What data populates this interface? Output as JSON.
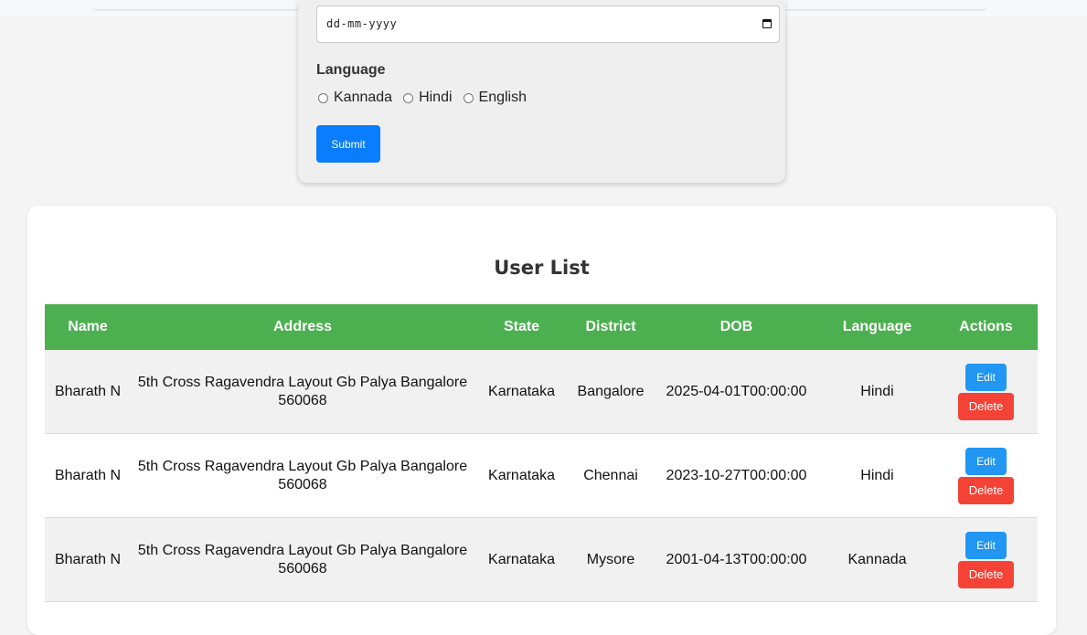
{
  "form": {
    "dob_placeholder": "dd-mm-yyyy",
    "language_label": "Language",
    "language_options": [
      "Kannada",
      "Hindi",
      "English"
    ],
    "submit_label": "Submit"
  },
  "user_list": {
    "title": "User List",
    "columns": [
      "Name",
      "Address",
      "State",
      "District",
      "DOB",
      "Language",
      "Actions"
    ],
    "edit_label": "Edit",
    "delete_label": "Delete",
    "rows": [
      {
        "name": "Bharath N",
        "address": "5th Cross Ragavendra Layout Gb Palya Bangalore 560068",
        "state": "Karnataka",
        "district": "Bangalore",
        "dob": "2025-04-01T00:00:00",
        "language": "Hindi"
      },
      {
        "name": "Bharath N",
        "address": "5th Cross Ragavendra Layout Gb Palya Bangalore 560068",
        "state": "Karnataka",
        "district": "Chennai",
        "dob": "2023-10-27T00:00:00",
        "language": "Hindi"
      },
      {
        "name": "Bharath N",
        "address": "5th Cross Ragavendra Layout Gb Palya Bangalore 560068",
        "state": "Karnataka",
        "district": "Mysore",
        "dob": "2001-04-13T00:00:00",
        "language": "Kannada"
      }
    ]
  },
  "colors": {
    "header_green": "#4caf50",
    "submit_blue": "#0a7cff",
    "edit_blue": "#2196f3",
    "delete_red": "#f44336"
  }
}
